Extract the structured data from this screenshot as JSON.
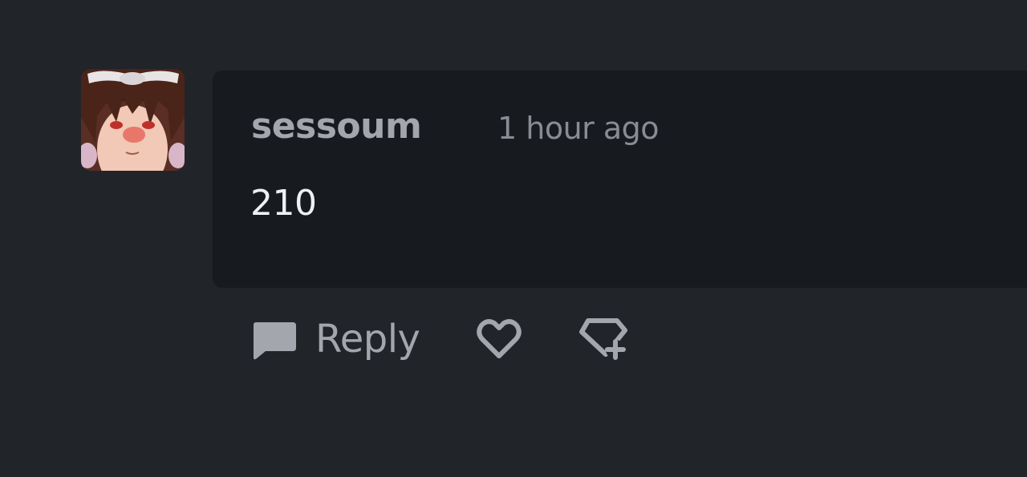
{
  "comment": {
    "author": "sessoum",
    "time": "1 hour ago",
    "text": "210",
    "avatar_icon": "user-avatar"
  },
  "actions": {
    "reply_label": "Reply",
    "reply_icon": "comment-bubble-icon",
    "like_icon": "heart-icon",
    "award_icon": "gem-plus-icon"
  },
  "colors": {
    "background": "#212429",
    "bubble": "#171a1f",
    "author": "#a3a6ad",
    "time": "#898c93",
    "text": "#eef0f2",
    "icon": "#a3a6ad"
  }
}
